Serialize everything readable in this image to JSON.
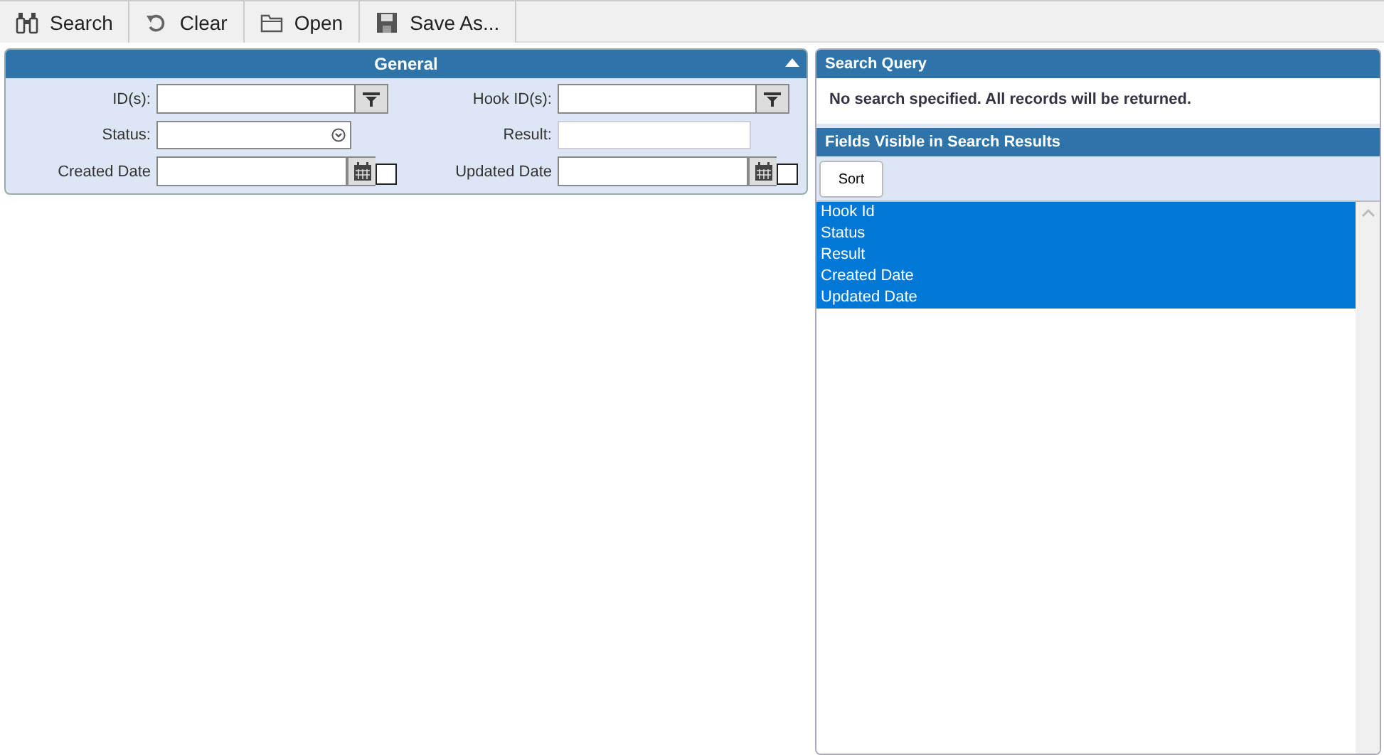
{
  "toolbar": [
    {
      "label": "Search",
      "kind": "search"
    },
    {
      "label": "Clear",
      "kind": "clear"
    },
    {
      "label": "Open",
      "kind": "open"
    },
    {
      "label": "Save As...",
      "kind": "save"
    }
  ],
  "general": {
    "title": "General",
    "expanded": true,
    "fields": [
      {
        "label": "ID(s):",
        "kind": "filter"
      },
      {
        "label": "Hook ID(s):",
        "kind": "filter"
      },
      {
        "label": "Status:",
        "kind": "select"
      },
      {
        "label": "Result:",
        "kind": "text"
      },
      {
        "label": "Created Date",
        "kind": "date",
        "checked": false
      },
      {
        "label": "Updated Date",
        "kind": "date",
        "checked": false
      }
    ]
  },
  "search_query": {
    "title": "Search Query",
    "text": "No search specified. All records will be returned."
  },
  "visible_fields": {
    "title": "Fields Visible in Search Results",
    "sort_button": "Sort",
    "items": [
      {
        "label": "Hook Id",
        "selected": true
      },
      {
        "label": "Status",
        "selected": true
      },
      {
        "label": "Result",
        "selected": true
      },
      {
        "label": "Created Date",
        "selected": true
      },
      {
        "label": "Updated Date",
        "selected": true
      }
    ]
  }
}
